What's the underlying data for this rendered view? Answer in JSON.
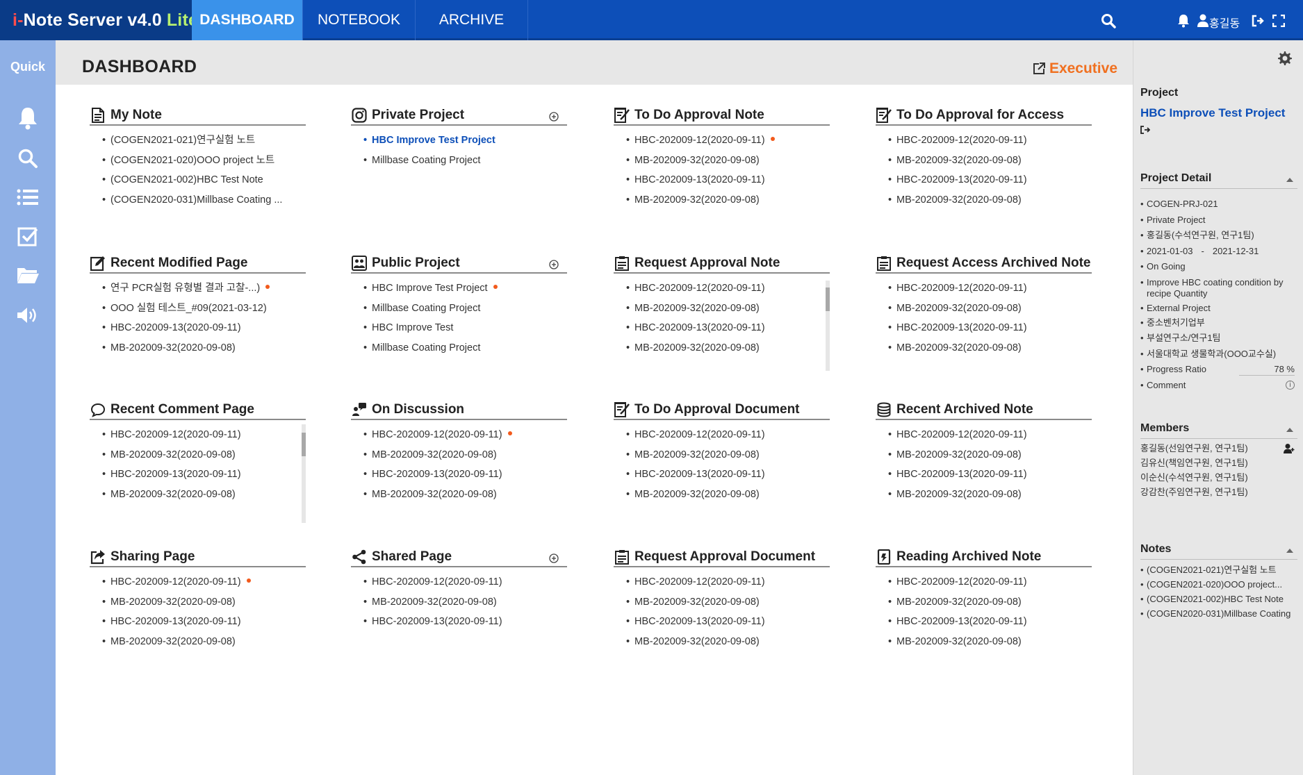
{
  "app": {
    "brand_part1": "i-",
    "brand_part2": "Note Server v4.0",
    "brand_part3": "Lite",
    "colors": {
      "primary": "#0d4fb8",
      "active_tab": "#3a92ea",
      "accent": "#f07020",
      "quickbar": "#8fb0e6",
      "new_dot": "#f25a1c"
    }
  },
  "nav": {
    "tabs": [
      {
        "label": "DASHBOARD",
        "active": true
      },
      {
        "label": "NOTEBOOK",
        "active": false
      },
      {
        "label": "ARCHIVE",
        "active": false
      }
    ],
    "icons": [
      "search-icon",
      "bell-icon",
      "user-icon",
      "logout-icon",
      "fullscreen-icon"
    ],
    "user_name": "홍길동"
  },
  "quick": {
    "label": "Quick",
    "icons": [
      "bell-icon",
      "search-icon",
      "list-icon",
      "checkbox-icon",
      "folder-icon",
      "speaker-icon"
    ]
  },
  "main": {
    "title": "DASHBOARD",
    "executive_label": "Executive"
  },
  "cards": {
    "my_note": {
      "title": "My Note",
      "icon": "note-icon",
      "items": [
        "(COGEN2021-021)연구실험 노트",
        "(COGEN2021-020)OOO project 노트",
        "(COGEN2021-002)HBC Test Note",
        "(COGEN2020-031)Millbase Coating ..."
      ]
    },
    "private_project": {
      "title": "Private Project",
      "icon": "instagram-icon",
      "items": [
        "HBC Improve Test Project",
        "Millbase Coating Project"
      ]
    },
    "todo_approval_note": {
      "title": "To Do Approval Note",
      "icon": "approval-icon",
      "items": [
        "HBC-202009-12(2020-09-11)",
        "MB-202009-32(2020-09-08)",
        "HBC-202009-13(2020-09-11)",
        "MB-202009-32(2020-09-08)"
      ]
    },
    "todo_approval_access": {
      "title": "To Do Approval for Access",
      "icon": "approval-icon",
      "items": [
        "HBC-202009-12(2020-09-11)",
        "MB-202009-32(2020-09-08)",
        "HBC-202009-13(2020-09-11)",
        "MB-202009-32(2020-09-08)"
      ]
    },
    "recent_modified": {
      "title": "Recent Modified Page",
      "icon": "edit-icon",
      "items": [
        "연구 PCR실험 유형별 결과 고찰-...)",
        "OOO 실험 테스트_#09(2021-03-12)",
        "HBC-202009-13(2020-09-11)",
        "MB-202009-32(2020-09-08)"
      ]
    },
    "public_project": {
      "title": "Public Project",
      "icon": "group-icon",
      "items": [
        "HBC Improve Test Project",
        "Millbase Coating Project",
        "HBC Improve Test",
        "Millbase Coating Project"
      ]
    },
    "request_approval_note": {
      "title": "Request Approval Note",
      "icon": "clipboard-icon",
      "items": [
        "HBC-202009-12(2020-09-11)",
        "MB-202009-32(2020-09-08)",
        "HBC-202009-13(2020-09-11)",
        "MB-202009-32(2020-09-08)"
      ]
    },
    "request_access_archived": {
      "title": "Request Access Archived Note",
      "icon": "clipboard-icon",
      "items": [
        "HBC-202009-12(2020-09-11)",
        "MB-202009-32(2020-09-08)",
        "HBC-202009-13(2020-09-11)",
        "MB-202009-32(2020-09-08)"
      ]
    },
    "recent_comment": {
      "title": "Recent Comment Page",
      "icon": "comment-icon",
      "items": [
        "HBC-202009-12(2020-09-11)",
        "MB-202009-32(2020-09-08)",
        "HBC-202009-13(2020-09-11)",
        "MB-202009-32(2020-09-08)"
      ]
    },
    "on_discussion": {
      "title": "On Discussion",
      "icon": "discussion-icon",
      "items": [
        "HBC-202009-12(2020-09-11)",
        "MB-202009-32(2020-09-08)",
        "HBC-202009-13(2020-09-11)",
        "MB-202009-32(2020-09-08)"
      ]
    },
    "todo_approval_document": {
      "title": "To Do Approval Document",
      "icon": "approval-icon",
      "items": [
        "HBC-202009-12(2020-09-11)",
        "MB-202009-32(2020-09-08)",
        "HBC-202009-13(2020-09-11)",
        "MB-202009-32(2020-09-08)"
      ]
    },
    "recent_archived": {
      "title": "Recent Archived Note",
      "icon": "database-icon",
      "items": [
        "HBC-202009-12(2020-09-11)",
        "MB-202009-32(2020-09-08)",
        "HBC-202009-13(2020-09-11)",
        "MB-202009-32(2020-09-08)"
      ]
    },
    "sharing_page": {
      "title": "Sharing Page",
      "icon": "share-out-icon",
      "items": [
        "HBC-202009-12(2020-09-11)",
        "MB-202009-32(2020-09-08)",
        "HBC-202009-13(2020-09-11)",
        "MB-202009-32(2020-09-08)"
      ]
    },
    "shared_page": {
      "title": "Shared Page",
      "icon": "share-icon",
      "items": [
        "HBC-202009-12(2020-09-11)",
        "MB-202009-32(2020-09-08)",
        "HBC-202009-13(2020-09-11)"
      ]
    },
    "request_approval_document": {
      "title": "Request Approval Document",
      "icon": "clipboard-icon",
      "items": [
        "HBC-202009-12(2020-09-11)",
        "MB-202009-32(2020-09-08)",
        "HBC-202009-13(2020-09-11)",
        "MB-202009-32(2020-09-08)"
      ]
    },
    "reading_archived": {
      "title": "Reading Archived Note",
      "icon": "book-icon",
      "items": [
        "HBC-202009-12(2020-09-11)",
        "MB-202009-32(2020-09-08)",
        "HBC-202009-13(2020-09-11)",
        "MB-202009-32(2020-09-08)"
      ]
    }
  },
  "right_panel": {
    "project_label": "Project",
    "project_name": "HBC Improve Test Project",
    "detail_title": "Project Detail",
    "detail": {
      "code": "COGEN-PRJ-021",
      "type": "Private Project",
      "owner": "홍길동(수석연구원, 연구1팀)",
      "start": "2021-01-03",
      "dash": "-",
      "end": "2021-12-31",
      "status": "On Going",
      "desc": "Improve HBC coating condition by recipe Quantity",
      "scope": "External Project",
      "business": "중소벤처기업부",
      "dept": "부설연구소/연구1팀",
      "partner": "서울대학교 생물학과(OOO교수실)",
      "progress_label": "Progress Ratio",
      "progress_value": "78 %",
      "comment_label": "Comment"
    },
    "members_title": "Members",
    "members": [
      "홍길동(선임연구원, 연구1팀)",
      "김유신(책임연구원, 연구1팀)",
      "이순신(수석연구원, 연구1팀)",
      "강감찬(주임연구원, 연구1팀)"
    ],
    "notes_title": "Notes",
    "notes": [
      "(COGEN2021-021)연구실험 노트",
      "(COGEN2021-020)OOO project...",
      "(COGEN2021-002)HBC Test Note",
      "(COGEN2020-031)Millbase Coating"
    ]
  }
}
